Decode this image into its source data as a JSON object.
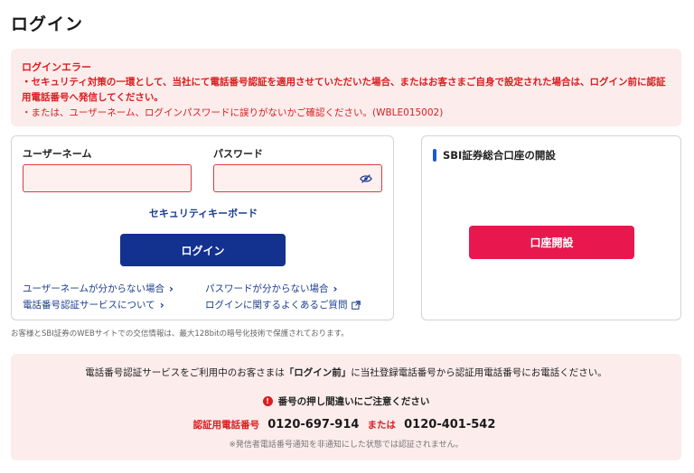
{
  "page": {
    "title": "ログイン"
  },
  "error": {
    "title": "ログインエラー",
    "line1": "・セキュリティ対策の一環として、当社にて電話番号認証を適用させていただいた場合、またはお客さまご自身で設定された場合は、ログイン前に認証用電話番号へ発信してください。",
    "line2": "・または、ユーザーネーム、ログインパスワードに誤りがないかご確認ください。(WBLE015002)"
  },
  "login": {
    "username_label": "ユーザーネーム",
    "username_value": "",
    "password_label": "パスワード",
    "password_value": "",
    "keyboard_link": "セキュリティキーボード",
    "login_button": "ログイン",
    "forgot_username": "ユーザーネームが分からない場合",
    "forgot_password": "パスワードが分からない場合",
    "phone_auth_service": "電話番号認証サービスについて",
    "faq": "ログインに関するよくあるご質問"
  },
  "account_open": {
    "title": "SBI証券総合口座の開設",
    "button": "口座開設"
  },
  "security_note": "お客様とSBI証券のWEBサイトでの交信情報は、最大128bitの暗号化技術で保護されております。",
  "phone_auth": {
    "intro_prefix": "電話番号認証サービスをご利用中のお客さまは",
    "intro_bold": "「ログイン前」",
    "intro_suffix": "に当社登録電話番号から認証用電話番号にお電話ください。",
    "caution": "番号の押し間違いにご注意ください",
    "number_label": "認証用電話番号",
    "number1": "0120-697-914",
    "or_label": "または",
    "number2": "0120-401-542",
    "note": "※発信者電話番号通知を非通知にした状態では認証されません。"
  },
  "colors": {
    "error_red": "#d81e1e",
    "login_navy": "#13318e",
    "open_pink": "#e8174e",
    "link_blue": "#1a3d8f",
    "alert_bg": "#fdecec"
  },
  "icons": {
    "password_toggle": "eye-slash-icon",
    "chevron": "chevron-right-icon",
    "external": "external-link-icon",
    "caution": "exclamation-circle-icon"
  }
}
